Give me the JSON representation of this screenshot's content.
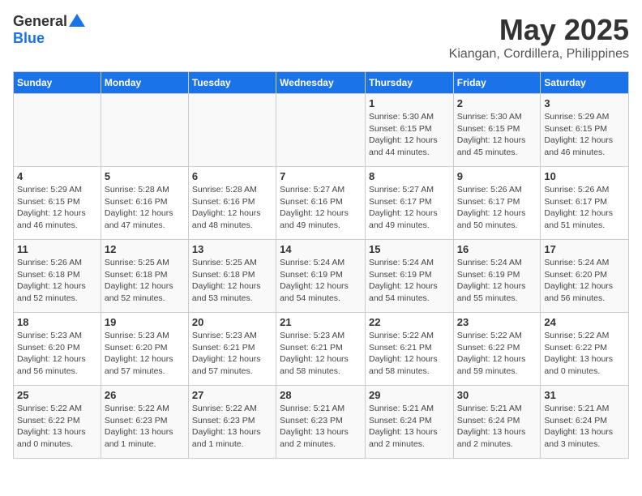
{
  "header": {
    "logo_general": "General",
    "logo_blue": "Blue",
    "month_title": "May 2025",
    "location": "Kiangan, Cordillera, Philippines"
  },
  "days_of_week": [
    "Sunday",
    "Monday",
    "Tuesday",
    "Wednesday",
    "Thursday",
    "Friday",
    "Saturday"
  ],
  "weeks": [
    [
      {
        "day": "",
        "info": ""
      },
      {
        "day": "",
        "info": ""
      },
      {
        "day": "",
        "info": ""
      },
      {
        "day": "",
        "info": ""
      },
      {
        "day": "1",
        "info": "Sunrise: 5:30 AM\nSunset: 6:15 PM\nDaylight: 12 hours\nand 44 minutes."
      },
      {
        "day": "2",
        "info": "Sunrise: 5:30 AM\nSunset: 6:15 PM\nDaylight: 12 hours\nand 45 minutes."
      },
      {
        "day": "3",
        "info": "Sunrise: 5:29 AM\nSunset: 6:15 PM\nDaylight: 12 hours\nand 46 minutes."
      }
    ],
    [
      {
        "day": "4",
        "info": "Sunrise: 5:29 AM\nSunset: 6:15 PM\nDaylight: 12 hours\nand 46 minutes."
      },
      {
        "day": "5",
        "info": "Sunrise: 5:28 AM\nSunset: 6:16 PM\nDaylight: 12 hours\nand 47 minutes."
      },
      {
        "day": "6",
        "info": "Sunrise: 5:28 AM\nSunset: 6:16 PM\nDaylight: 12 hours\nand 48 minutes."
      },
      {
        "day": "7",
        "info": "Sunrise: 5:27 AM\nSunset: 6:16 PM\nDaylight: 12 hours\nand 49 minutes."
      },
      {
        "day": "8",
        "info": "Sunrise: 5:27 AM\nSunset: 6:17 PM\nDaylight: 12 hours\nand 49 minutes."
      },
      {
        "day": "9",
        "info": "Sunrise: 5:26 AM\nSunset: 6:17 PM\nDaylight: 12 hours\nand 50 minutes."
      },
      {
        "day": "10",
        "info": "Sunrise: 5:26 AM\nSunset: 6:17 PM\nDaylight: 12 hours\nand 51 minutes."
      }
    ],
    [
      {
        "day": "11",
        "info": "Sunrise: 5:26 AM\nSunset: 6:18 PM\nDaylight: 12 hours\nand 52 minutes."
      },
      {
        "day": "12",
        "info": "Sunrise: 5:25 AM\nSunset: 6:18 PM\nDaylight: 12 hours\nand 52 minutes."
      },
      {
        "day": "13",
        "info": "Sunrise: 5:25 AM\nSunset: 6:18 PM\nDaylight: 12 hours\nand 53 minutes."
      },
      {
        "day": "14",
        "info": "Sunrise: 5:24 AM\nSunset: 6:19 PM\nDaylight: 12 hours\nand 54 minutes."
      },
      {
        "day": "15",
        "info": "Sunrise: 5:24 AM\nSunset: 6:19 PM\nDaylight: 12 hours\nand 54 minutes."
      },
      {
        "day": "16",
        "info": "Sunrise: 5:24 AM\nSunset: 6:19 PM\nDaylight: 12 hours\nand 55 minutes."
      },
      {
        "day": "17",
        "info": "Sunrise: 5:24 AM\nSunset: 6:20 PM\nDaylight: 12 hours\nand 56 minutes."
      }
    ],
    [
      {
        "day": "18",
        "info": "Sunrise: 5:23 AM\nSunset: 6:20 PM\nDaylight: 12 hours\nand 56 minutes."
      },
      {
        "day": "19",
        "info": "Sunrise: 5:23 AM\nSunset: 6:20 PM\nDaylight: 12 hours\nand 57 minutes."
      },
      {
        "day": "20",
        "info": "Sunrise: 5:23 AM\nSunset: 6:21 PM\nDaylight: 12 hours\nand 57 minutes."
      },
      {
        "day": "21",
        "info": "Sunrise: 5:23 AM\nSunset: 6:21 PM\nDaylight: 12 hours\nand 58 minutes."
      },
      {
        "day": "22",
        "info": "Sunrise: 5:22 AM\nSunset: 6:21 PM\nDaylight: 12 hours\nand 58 minutes."
      },
      {
        "day": "23",
        "info": "Sunrise: 5:22 AM\nSunset: 6:22 PM\nDaylight: 12 hours\nand 59 minutes."
      },
      {
        "day": "24",
        "info": "Sunrise: 5:22 AM\nSunset: 6:22 PM\nDaylight: 13 hours\nand 0 minutes."
      }
    ],
    [
      {
        "day": "25",
        "info": "Sunrise: 5:22 AM\nSunset: 6:22 PM\nDaylight: 13 hours\nand 0 minutes."
      },
      {
        "day": "26",
        "info": "Sunrise: 5:22 AM\nSunset: 6:23 PM\nDaylight: 13 hours\nand 1 minute."
      },
      {
        "day": "27",
        "info": "Sunrise: 5:22 AM\nSunset: 6:23 PM\nDaylight: 13 hours\nand 1 minute."
      },
      {
        "day": "28",
        "info": "Sunrise: 5:21 AM\nSunset: 6:23 PM\nDaylight: 13 hours\nand 2 minutes."
      },
      {
        "day": "29",
        "info": "Sunrise: 5:21 AM\nSunset: 6:24 PM\nDaylight: 13 hours\nand 2 minutes."
      },
      {
        "day": "30",
        "info": "Sunrise: 5:21 AM\nSunset: 6:24 PM\nDaylight: 13 hours\nand 2 minutes."
      },
      {
        "day": "31",
        "info": "Sunrise: 5:21 AM\nSunset: 6:24 PM\nDaylight: 13 hours\nand 3 minutes."
      }
    ]
  ]
}
